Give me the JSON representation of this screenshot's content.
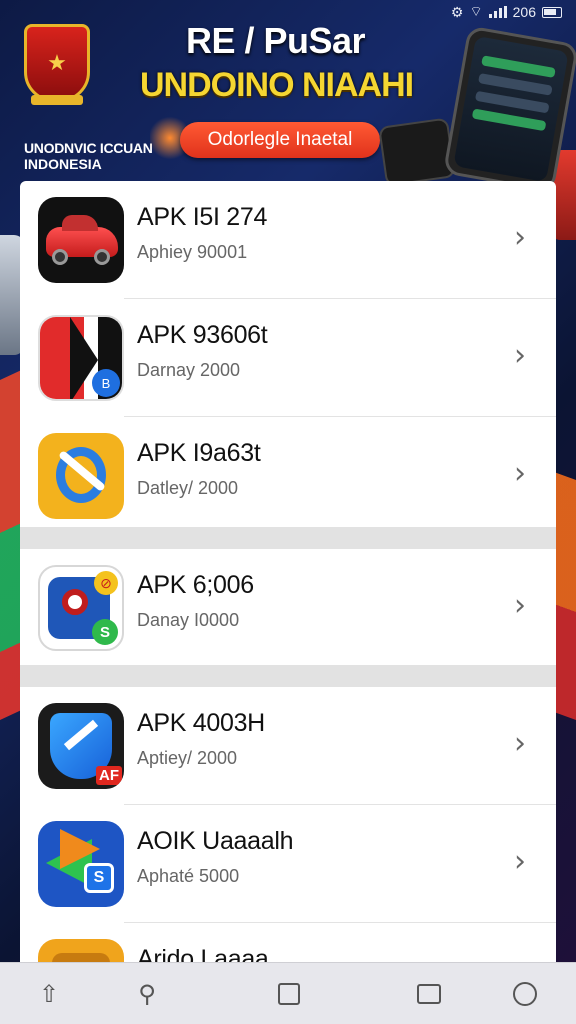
{
  "status_bar": {
    "time": "206",
    "icons": [
      "settings-icon",
      "wifi-icon",
      "signal-icon",
      "battery-icon"
    ]
  },
  "banner": {
    "title": "RE / PuSar",
    "subtitle": "UNDOINO NIAAHI",
    "small_line1": "UNODNVIC ICCUAN",
    "small_line2": "INDONESIA",
    "button_label": "Odorlegle Inaetal"
  },
  "apps": [
    {
      "title": "APK I5I 274",
      "subtitle": "Aphiey 90001",
      "icon": "red-car-app-icon"
    },
    {
      "title": "APK 93606t",
      "subtitle": "Darnay 2000",
      "icon": "red-black-app-icon"
    },
    {
      "title": "APK I9a63t",
      "subtitle": "Datley/ 2000",
      "icon": "yellow-blue-app-icon"
    },
    {
      "title": "APK 6;006",
      "subtitle": "Danay I0000",
      "icon": "blue-green-app-icon"
    },
    {
      "title": "APK 4003H",
      "subtitle": "Aptiey/ 2000",
      "icon": "blue-shield-app-icon"
    },
    {
      "title": "AOIK Uaaaalh",
      "subtitle": "Aphaté 5000",
      "icon": "colorful-arrow-app-icon"
    },
    {
      "title": "Arido Laaaa",
      "subtitle": "",
      "icon": "orange-app-icon"
    }
  ],
  "bottom_nav": {
    "items": [
      "home-icon",
      "search-icon",
      "bookmark-icon",
      "tabs-icon",
      "share-icon"
    ]
  },
  "colors": {
    "background": "#0d1a45",
    "accent_red": "#e0321c",
    "accent_yellow": "#f5d632",
    "panel": "#ffffff"
  }
}
